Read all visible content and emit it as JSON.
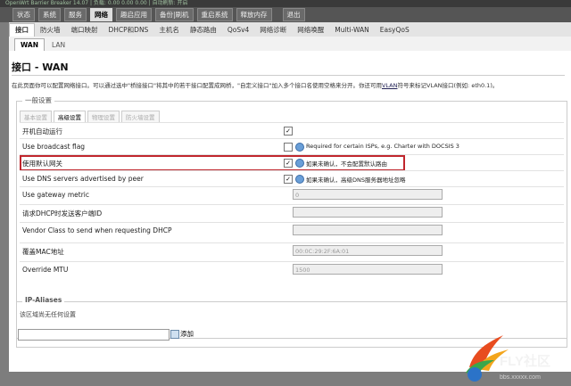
{
  "top_strip": "OpenWrt Barrier Breaker 14.07 | 负载: 0.00 0.00 0.00 | 自动刷新: 开启",
  "menubar": {
    "items": [
      "状态",
      "系统",
      "服务",
      "网络",
      "趣启应用",
      "备份|刷机",
      "重启系统",
      "释放内存",
      "退出"
    ],
    "active_index": 3
  },
  "subnav": {
    "items": [
      "接口",
      "防火墙",
      "端口映射",
      "DHCP和DNS",
      "主机名",
      "静态路由",
      "QoSv4",
      "网络诊断",
      "网络唤醒",
      "Multi-WAN",
      "EasyQoS"
    ],
    "active_index": 0
  },
  "tabs": {
    "items": [
      "WAN",
      "LAN"
    ],
    "active_index": 0
  },
  "page": {
    "title": "接口 - WAN",
    "description_prefix": "在此页面你可以配置网络接口。可以通过选中\"桥接接口\"将其中的若干接口配置成网桥，\"自定义接口\"加入多个接口名使用空格来分开。你还可用",
    "description_link": "VLAN",
    "description_suffix": "符号来标记VLAN接口(例如: eth0.1)。"
  },
  "general": {
    "legend": "一般设置",
    "tabs": [
      "基本设置",
      "高级设置",
      "物理设置",
      "防火墙设置"
    ],
    "active_tab_index": 1,
    "rows": [
      {
        "label": "开机自动运行",
        "checked": true
      },
      {
        "label": "Use broadcast flag",
        "checked": false,
        "hint": "Required for certain ISPs, e.g. Charter with DOCSIS 3"
      },
      {
        "label": "使用默认网关",
        "checked": true,
        "hint": "如果未确认，不会配置默认路由",
        "highlighted": true
      },
      {
        "label": "Use DNS servers advertised by peer",
        "checked": true,
        "hint": "如果未确认，高级DNS服务器地址忽略"
      },
      {
        "label": "Use gateway metric",
        "placeholder": "0"
      },
      {
        "label": "请求DHCP时发送客户端ID",
        "placeholder": ""
      },
      {
        "label": "Vendor Class to send when requesting DHCP",
        "placeholder": ""
      },
      {
        "label": "覆盖MAC地址",
        "placeholder": "00:0C:29:2F:6A:01"
      },
      {
        "label": "Override MTU",
        "placeholder": "1500"
      }
    ]
  },
  "aliases": {
    "legend": "IP-Aliases",
    "empty_text": "该区域尚无任何设置",
    "add_label": "添加"
  },
  "watermark": {
    "text": "FLY社区",
    "sub": "bbs.xxxxx.com"
  },
  "colors": {
    "highlight": "#c0262d",
    "info_icon": "#6a9fd8"
  }
}
